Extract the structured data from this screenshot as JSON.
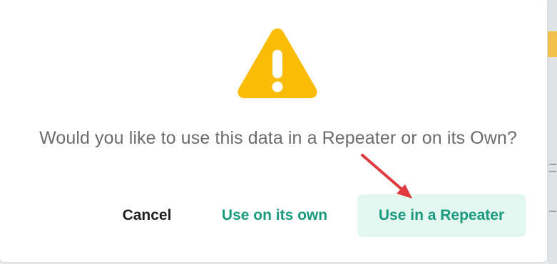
{
  "dialog": {
    "message": "Would you like to use this data in a Repeater or on its Own?",
    "icon": "warning-icon",
    "colors": {
      "icon": "#fbbc05",
      "accent": "#1a9a7d",
      "primary_bg": "#e3f6f0",
      "arrow": "#e0393e"
    },
    "buttons": {
      "cancel": "Cancel",
      "use_own": "Use on its own",
      "use_repeater": "Use in a Repeater"
    }
  }
}
